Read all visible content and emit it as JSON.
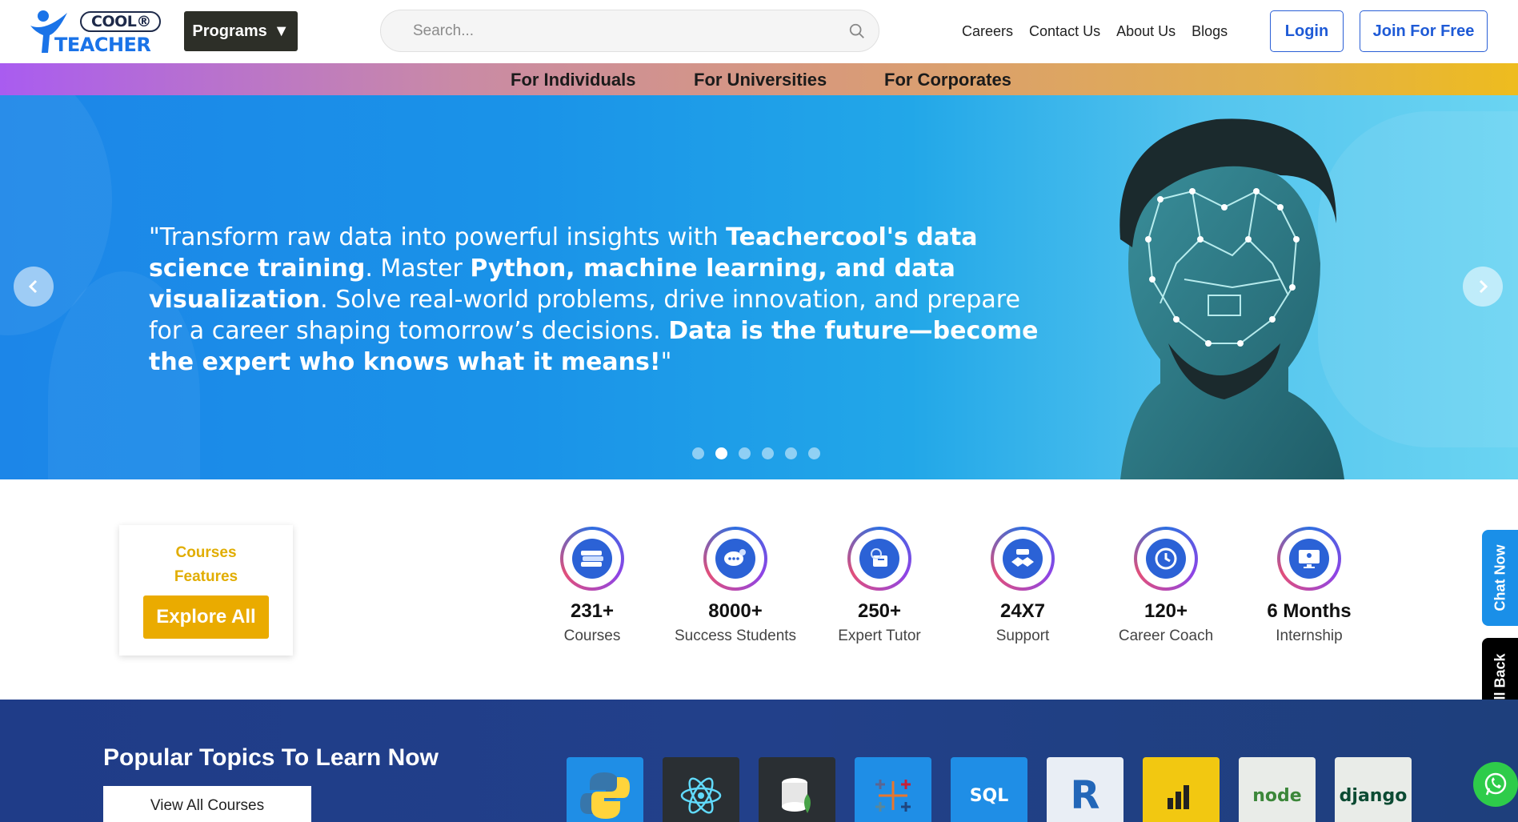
{
  "header": {
    "logo_top": "COOL®",
    "logo_bottom": "TEACHER",
    "programs_label": "Programs",
    "programs_caret": "▼",
    "search_placeholder": "Search...",
    "nav": [
      "Careers",
      "Contact Us",
      "About Us",
      "Blogs"
    ],
    "login_label": "Login",
    "join_label": "Join For Free"
  },
  "subnav": [
    "For Individuals",
    "For Universities",
    "For Corporates"
  ],
  "hero": {
    "text_1": "\"Transform raw data into powerful insights with ",
    "text_2": "Teachercool's data science training",
    "text_3": ". Master ",
    "text_4": "Python, machine learning, and data visualization",
    "text_5": ". Solve real-world problems, drive innovation, and prepare for a career shaping tomorrow’s decisions. ",
    "text_6": "Data is the future—become the expert who knows what it means!",
    "text_7": "\"",
    "slide_count": 6,
    "active_slide": 2
  },
  "features": {
    "title_1": "Courses",
    "title_2": "Features",
    "explore_label": "Explore All"
  },
  "stats": [
    {
      "value": "231+",
      "label": "Courses",
      "icon": "books-icon"
    },
    {
      "value": "8000+",
      "label": "Success Students",
      "icon": "chat-student-icon"
    },
    {
      "value": "250+",
      "label": "Expert Tutor",
      "icon": "tutor-icon"
    },
    {
      "value": "24X7",
      "label": "Support",
      "icon": "handshake-icon"
    },
    {
      "value": "120+",
      "label": "Career Coach",
      "icon": "clock-icon"
    },
    {
      "value": "6 Months",
      "label": "Internship",
      "icon": "monitor-icon"
    }
  ],
  "side": {
    "chat_now": "Chat Now",
    "call_back": "Call Back"
  },
  "popular": {
    "heading": "Popular Topics To Learn Now",
    "view_all": "View All Courses",
    "topics": [
      {
        "name": "python-icon",
        "text": "",
        "bg": "#1f8ee6"
      },
      {
        "name": "react-icon",
        "text": "",
        "bg": "#1f8ee6"
      },
      {
        "name": "mongodb-icon",
        "text": "",
        "bg": "#1f8ee6"
      },
      {
        "name": "tableau-icon",
        "text": "",
        "bg": "#1f8ee6"
      },
      {
        "name": "sql-icon",
        "text": "SQL",
        "bg": "#1f8ee6"
      },
      {
        "name": "r-language-icon",
        "text": "R",
        "bg": "#1f8ee6"
      },
      {
        "name": "power-bi-icon",
        "text": "",
        "bg": "#1f8ee6"
      },
      {
        "name": "nodejs-icon",
        "text": "node",
        "bg": "#1f8ee6"
      },
      {
        "name": "django-icon",
        "text": "django",
        "bg": "#1f8ee6"
      }
    ]
  }
}
